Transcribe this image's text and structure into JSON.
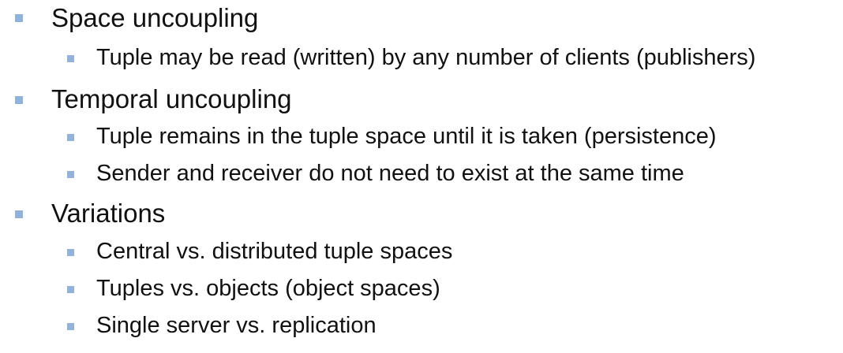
{
  "accent_color": "#8fb3dd",
  "bullet_icon": "square-bullet-icon",
  "items": [
    {
      "level": 1,
      "text": "Space uncoupling"
    },
    {
      "level": 2,
      "text": "Tuple may be read (written) by any number of clients (publishers)"
    },
    {
      "level": 1,
      "text": "Temporal uncoupling"
    },
    {
      "level": 2,
      "text": "Tuple remains in the tuple space until it is taken (persistence)"
    },
    {
      "level": 2,
      "text": "Sender and receiver do not need to exist at the same time"
    },
    {
      "level": 1,
      "text": "Variations"
    },
    {
      "level": 2,
      "text": "Central vs. distributed tuple spaces"
    },
    {
      "level": 2,
      "text": "Tuples vs. objects (object spaces)"
    },
    {
      "level": 2,
      "text": "Single server vs. replication"
    }
  ]
}
